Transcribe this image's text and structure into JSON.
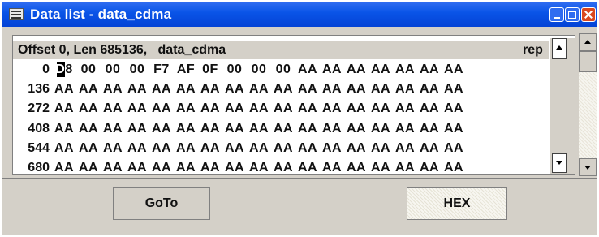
{
  "window": {
    "title": "Data list - data_cdma"
  },
  "header": {
    "info": "Offset 0, Len 685136,   data_cdma",
    "rep": "rep"
  },
  "rows": [
    {
      "offset": "0",
      "bytes": [
        "D8",
        "00",
        "00",
        "00",
        "F7",
        "AF",
        "0F",
        "00",
        "00",
        "00",
        "AA",
        "AA",
        "AA",
        "AA",
        "AA",
        "AA",
        "AA"
      ]
    },
    {
      "offset": "136",
      "bytes": [
        "AA",
        "AA",
        "AA",
        "AA",
        "AA",
        "AA",
        "AA",
        "AA",
        "AA",
        "AA",
        "AA",
        "AA",
        "AA",
        "AA",
        "AA",
        "AA",
        "AA"
      ]
    },
    {
      "offset": "272",
      "bytes": [
        "AA",
        "AA",
        "AA",
        "AA",
        "AA",
        "AA",
        "AA",
        "AA",
        "AA",
        "AA",
        "AA",
        "AA",
        "AA",
        "AA",
        "AA",
        "AA",
        "AA"
      ]
    },
    {
      "offset": "408",
      "bytes": [
        "AA",
        "AA",
        "AA",
        "AA",
        "AA",
        "AA",
        "AA",
        "AA",
        "AA",
        "AA",
        "AA",
        "AA",
        "AA",
        "AA",
        "AA",
        "AA",
        "AA"
      ]
    },
    {
      "offset": "544",
      "bytes": [
        "AA",
        "AA",
        "AA",
        "AA",
        "AA",
        "AA",
        "AA",
        "AA",
        "AA",
        "AA",
        "AA",
        "AA",
        "AA",
        "AA",
        "AA",
        "AA",
        "AA"
      ]
    },
    {
      "offset": "680",
      "bytes": [
        "AA",
        "AA",
        "AA",
        "AA",
        "AA",
        "AA",
        "AA",
        "AA",
        "AA",
        "AA",
        "AA",
        "AA",
        "AA",
        "AA",
        "AA",
        "AA",
        "AA"
      ]
    }
  ],
  "buttons": {
    "goto": "GoTo",
    "hex": "HEX"
  },
  "icons": {
    "app": "keyboard-icon",
    "minimize": "minimize-icon",
    "maximize": "maximize-icon",
    "close": "close-icon",
    "scroll_up": "arrow-up-icon",
    "scroll_down": "arrow-down-icon"
  },
  "colors": {
    "titlebar": "#0a55e8",
    "close": "#d9471f",
    "face": "#d4d0c8"
  }
}
